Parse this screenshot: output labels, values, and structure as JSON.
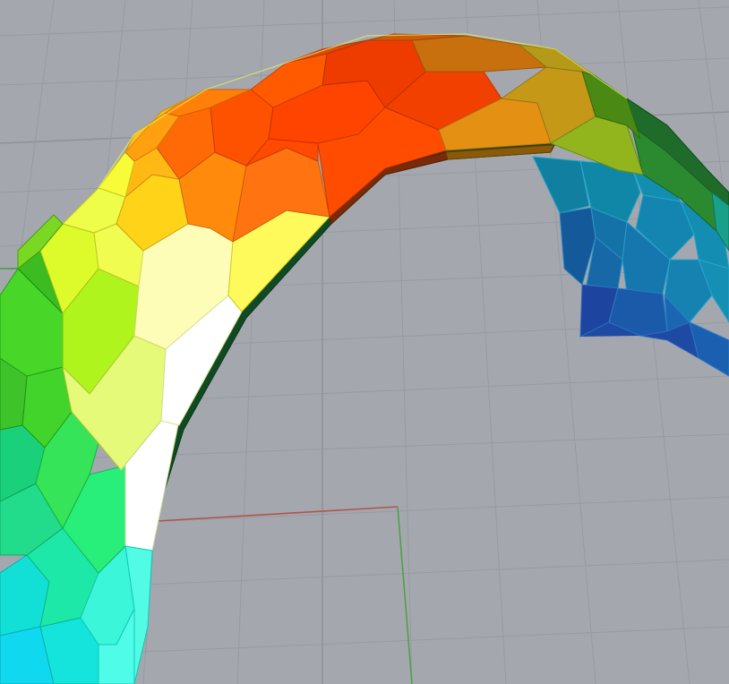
{
  "viewport": {
    "colors": {
      "background": "#a4a8ae",
      "grid": "#8e9298",
      "axis_x": "#b0534b",
      "axis_y": "#4fa04a"
    }
  },
  "model": {
    "shape": "arch",
    "surface": "voronoi-cells",
    "color_ramp": [
      "#1f44a0",
      "#1f88b0",
      "#18d8e8",
      "#2de47a",
      "#5bd62a",
      "#b6f61c",
      "#f4fb5a",
      "#ffffff",
      "#ffd21c",
      "#ff8f10",
      "#ff4a00",
      "#e28b10",
      "#8fb41e",
      "#3f7f12"
    ]
  }
}
